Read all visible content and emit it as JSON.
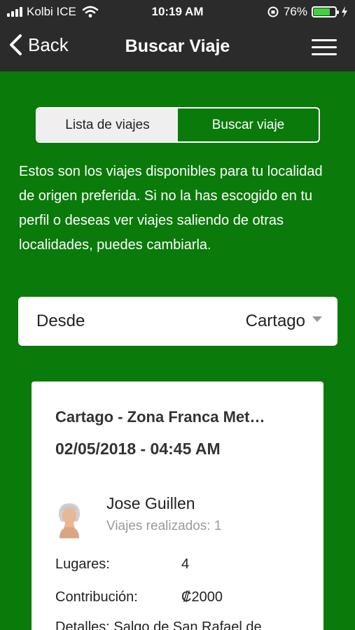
{
  "status": {
    "carrier": "Kolbi ICE",
    "time": "10:19 AM",
    "battery": "76%",
    "battery_level": 0.76
  },
  "nav": {
    "back_label": "Back",
    "title": "Buscar Viaje"
  },
  "tabs": [
    {
      "label": "Lista de viajes",
      "active": true
    },
    {
      "label": "Buscar viaje",
      "active": false
    }
  ],
  "intro_text": "Estos son los viajes disponibles para tu localidad de origen preferida. Si no la has escogido en tu perfil o deseas ver viajes saliendo de otras localidades, puedes cambiarla.",
  "origin_picker": {
    "label": "Desde",
    "value": "Cartago"
  },
  "trip": {
    "route": "Cartago - Zona Franca Met…",
    "datetime": "02/05/2018 - 04:45 AM",
    "driver_name": "Jose Guillen",
    "driver_trips": "Viajes realizados: 1",
    "seats_label": "Lugares:",
    "seats_value": "4",
    "contribution_label": "Contribución:",
    "contribution_value": "₡2000",
    "details": "Detalles: Salgo de San Rafael de"
  },
  "colors": {
    "background": "#0a7a0a",
    "bar": "#2b2b2b",
    "battery": "#3ed23e"
  }
}
